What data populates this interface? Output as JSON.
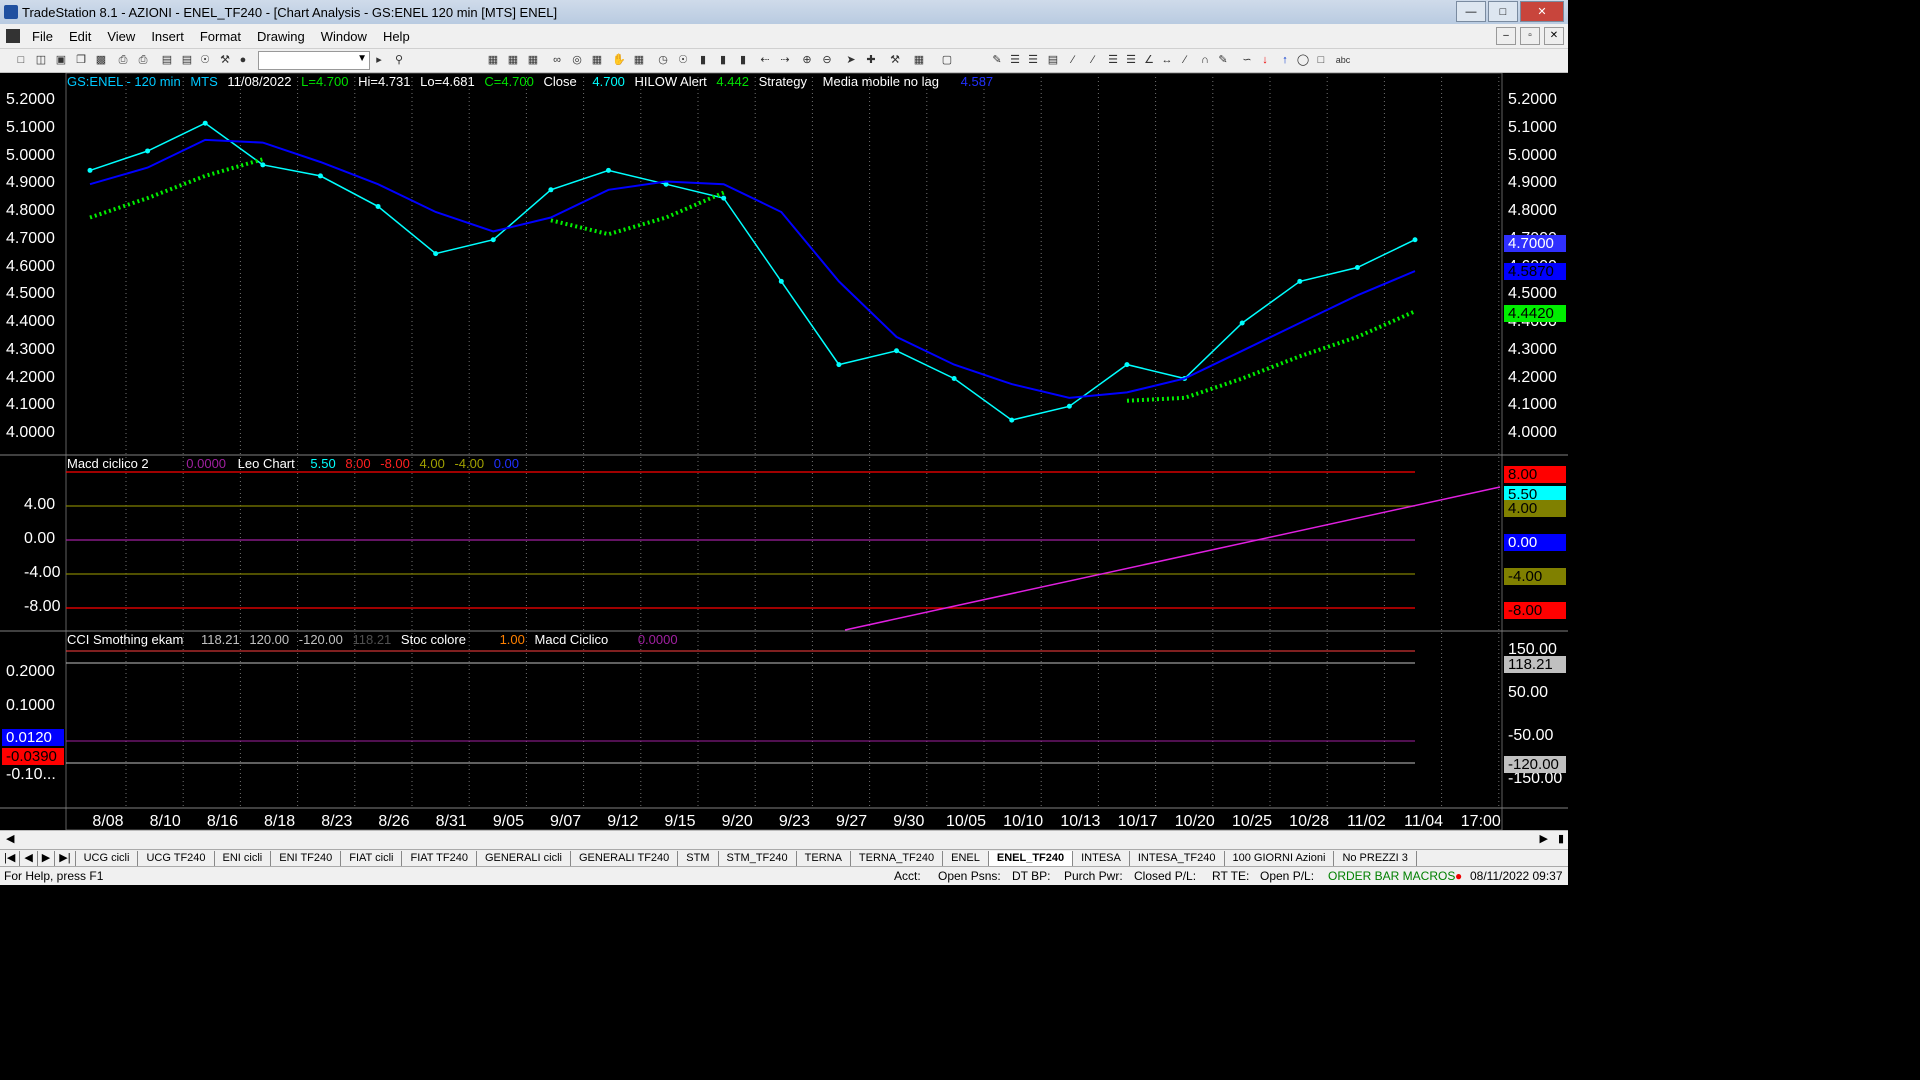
{
  "window": {
    "title": "TradeStation 8.1 - AZIONI - ENEL_TF240 - [Chart Analysis - GS:ENEL  120 min  [MTS] ENEL]"
  },
  "menu": [
    "File",
    "Edit",
    "View",
    "Insert",
    "Format",
    "Drawing",
    "Window",
    "Help"
  ],
  "header1": {
    "symbol": "GS:ENEL - 120 min",
    "mts": "MTS",
    "date": "11/08/2022",
    "last": "L=4.700",
    "hi": "Hi=4.731",
    "lo": "Lo=4.681",
    "close_c": "C=4.700",
    "close_label": "Close",
    "close_val": "4.700",
    "hilow_label": "HILOW Alert",
    "hilow_val": "4.442",
    "strategy": "Strategy",
    "media_label": "Media mobile no lag",
    "media_val": "4.587"
  },
  "header2": {
    "name": "Macd ciclico 2",
    "v0": "0.0000",
    "leo": "Leo Chart",
    "v1": "5.50",
    "v2": "8.00",
    "v3": "-8.00",
    "v4": "4.00",
    "v5": "-4.00",
    "v6": "0.00"
  },
  "header3": {
    "name": "CCI Smothing ekam",
    "v1": "118.21",
    "v2": "120.00",
    "v3": "-120.00",
    "v4": "118.21",
    "stoc": "Stoc colore",
    "stoc_v": "1.00",
    "macd": "Macd Ciclico",
    "macd_v": "0.0000"
  },
  "price_axis_left": [
    "5.2000",
    "5.1000",
    "5.0000",
    "4.9000",
    "4.8000",
    "4.7000",
    "4.6000",
    "4.5000",
    "4.4000",
    "4.3000",
    "4.2000",
    "4.1000",
    "4.0000"
  ],
  "price_axis_right": [
    "5.2000",
    "5.1000",
    "5.0000",
    "4.9000",
    "4.8000",
    "4.7000",
    "4.6000",
    "4.5000",
    "4.4000",
    "4.3000",
    "4.2000",
    "4.1000",
    "4.0000"
  ],
  "price_tags": [
    {
      "text": "4.7000",
      "bg": "#3030ff",
      "fg": "#ffffff"
    },
    {
      "text": "4.5870",
      "bg": "#0000ff",
      "fg": "#000000"
    },
    {
      "text": "4.4420",
      "bg": "#00ee00",
      "fg": "#000000"
    }
  ],
  "macd_axis_left": [
    "4.00",
    "0.00",
    "-4.00",
    "-8.00"
  ],
  "macd_tags": [
    {
      "text": "8.00",
      "bg": "#ff0000",
      "fg": "#000000"
    },
    {
      "text": "5.50",
      "bg": "#00ffff",
      "fg": "#000000"
    },
    {
      "text": "4.00",
      "bg": "#808000",
      "fg": "#000000"
    },
    {
      "text": "0.00",
      "bg": "#0000ff",
      "fg": "#ffffff"
    },
    {
      "text": "-4.00",
      "bg": "#808000",
      "fg": "#000000"
    },
    {
      "text": "-8.00",
      "bg": "#ff0000",
      "fg": "#000000"
    }
  ],
  "cci_axis_left": [
    "0.2000",
    "0.1000",
    "-0.10..."
  ],
  "cci_left_tags": [
    {
      "text": "0.0120",
      "bg": "#0000ff",
      "fg": "#ffffff"
    },
    {
      "text": "-0.0390",
      "bg": "#ff0000",
      "fg": "#000000"
    }
  ],
  "cci_axis_right": [
    "150.00",
    "50.00",
    "-50.00",
    "-150.00"
  ],
  "cci_right_tags": [
    {
      "text": "118.21",
      "bg": "#c0c0c0",
      "fg": "#000000"
    },
    {
      "text": "-120.00",
      "bg": "#c0c0c0",
      "fg": "#000000"
    }
  ],
  "x_labels": [
    "8/08",
    "8/10",
    "8/16",
    "8/18",
    "8/23",
    "8/26",
    "8/31",
    "9/05",
    "9/07",
    "9/12",
    "9/15",
    "9/20",
    "9/23",
    "9/27",
    "9/30",
    "10/05",
    "10/10",
    "10/13",
    "10/17",
    "10/20",
    "10/25",
    "10/28",
    "11/02",
    "11/04",
    "17:00"
  ],
  "tabs": [
    "UCG cicli",
    "UCG TF240",
    "ENI cicli",
    "ENI TF240",
    "FIAT cicli",
    "FIAT TF240",
    "GENERALI cicli",
    "GENERALI TF240",
    "STM",
    "STM_TF240",
    "TERNA",
    "TERNA_TF240",
    "ENEL",
    "ENEL_TF240",
    "INTESA",
    "INTESA_TF240",
    "100 GIORNI Azioni",
    "No PREZZI 3"
  ],
  "active_tab": "ENEL_TF240",
  "status": {
    "help": "For Help, press F1",
    "acct": "Acct:",
    "open_psns": "Open Psns:",
    "dt_bp": "DT BP:",
    "purch": "Purch Pwr:",
    "closed": "Closed P/L:",
    "rt_te": "RT TE:",
    "open_pl": "Open P/L:",
    "macros": "ORDER BAR  MACROS",
    "datetime": "08/11/2022 09:37"
  },
  "chart_data": {
    "type": "line",
    "symbol": "GS:ENEL",
    "interval": "120 min",
    "ylim": [
      4.0,
      5.2
    ],
    "x": [
      "8/08",
      "8/10",
      "8/16",
      "8/18",
      "8/23",
      "8/26",
      "8/31",
      "9/05",
      "9/07",
      "9/12",
      "9/15",
      "9/20",
      "9/23",
      "9/27",
      "9/30",
      "10/05",
      "10/10",
      "10/13",
      "10/17",
      "10/20",
      "10/25",
      "10/28",
      "11/02",
      "11/04"
    ],
    "series": [
      {
        "name": "Close",
        "color": "#00ffff",
        "values": [
          4.95,
          5.02,
          5.12,
          4.97,
          4.93,
          4.82,
          4.65,
          4.7,
          4.88,
          4.95,
          4.9,
          4.85,
          4.55,
          4.25,
          4.3,
          4.2,
          4.05,
          4.1,
          4.25,
          4.2,
          4.4,
          4.55,
          4.6,
          4.7
        ]
      },
      {
        "name": "Media mobile no lag",
        "color": "#0000ff",
        "values": [
          4.9,
          4.96,
          5.06,
          5.05,
          4.98,
          4.9,
          4.8,
          4.73,
          4.78,
          4.88,
          4.91,
          4.9,
          4.8,
          4.55,
          4.35,
          4.25,
          4.18,
          4.13,
          4.15,
          4.2,
          4.3,
          4.4,
          4.5,
          4.587
        ]
      },
      {
        "name": "HILOW Alert",
        "color": "#00ee00",
        "values": [
          4.78,
          4.85,
          4.93,
          4.99,
          null,
          null,
          null,
          null,
          4.77,
          4.72,
          4.78,
          4.87,
          null,
          null,
          null,
          null,
          null,
          null,
          4.12,
          4.13,
          4.2,
          4.28,
          4.35,
          4.442
        ]
      }
    ]
  }
}
